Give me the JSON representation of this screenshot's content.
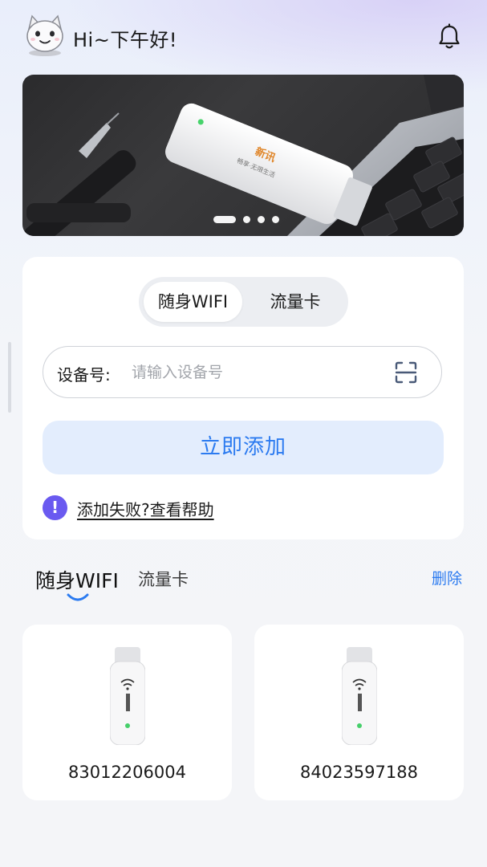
{
  "header": {
    "greeting": "Hi~下午好!",
    "avatar_icon": "cat-avatar-icon",
    "bell_icon": "bell-icon"
  },
  "banner": {
    "product_brand": "新讯",
    "product_slogan": "畅享·无限生活",
    "carousel": {
      "total": 4,
      "active_index": 0
    }
  },
  "add_card": {
    "tabs": [
      "随身WIFI",
      "流量卡"
    ],
    "active_tab": 0,
    "device_label": "设备号:",
    "device_placeholder": "请输入设备号",
    "device_value": "",
    "scan_icon": "scan-icon",
    "add_button": "立即添加",
    "help_icon": "exclamation-icon",
    "help_text": "添加失败?查看帮助"
  },
  "device_list": {
    "tabs": [
      "随身WIFI",
      "流量卡"
    ],
    "active_tab": 0,
    "delete_label": "删除",
    "devices": [
      {
        "id": "83012206004",
        "icon": "usb-wifi-dongle-icon"
      },
      {
        "id": "84023597188",
        "icon": "usb-wifi-dongle-icon"
      }
    ]
  },
  "colors": {
    "accent": "#2c7bf0",
    "add_button_bg": "#e3edfd",
    "help_icon_bg": "#6a5af0",
    "page_bg": "#f4f5f8"
  }
}
